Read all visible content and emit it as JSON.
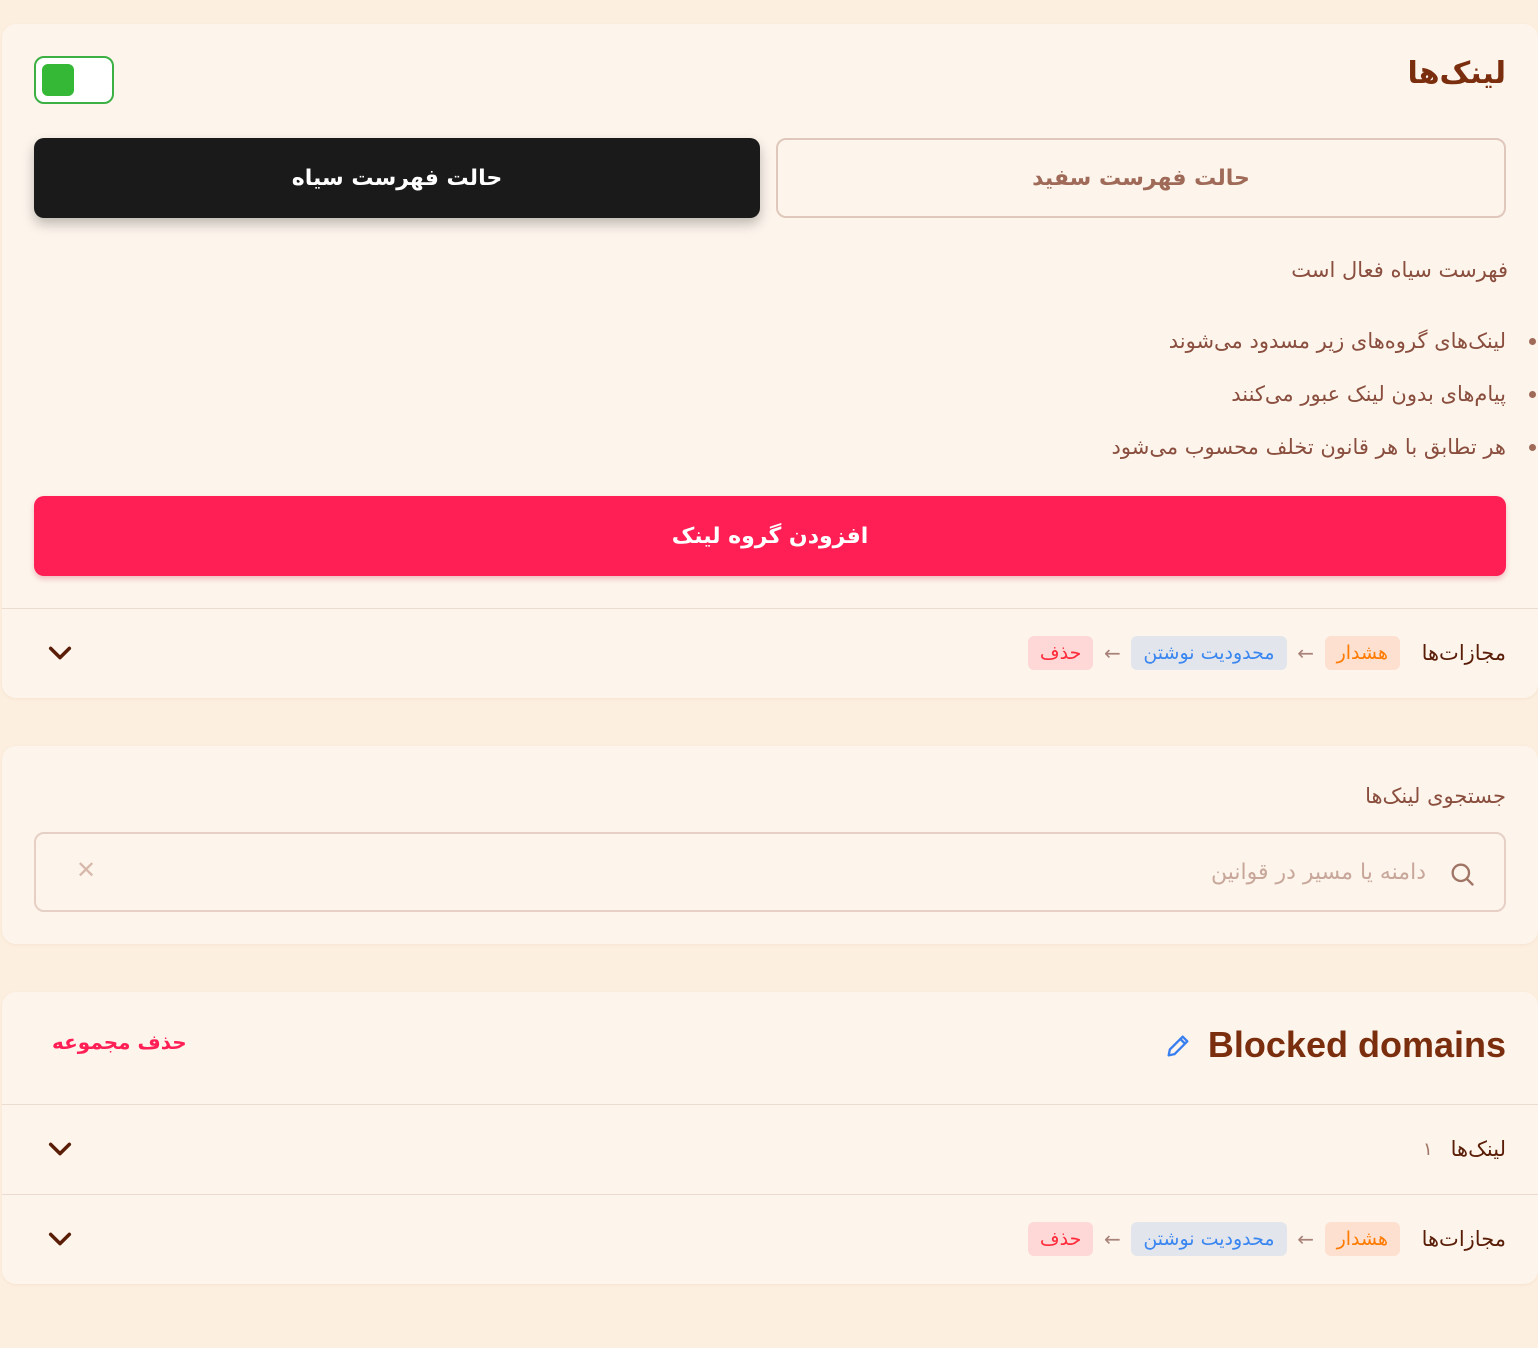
{
  "links_card": {
    "title": "لینک‌ها",
    "toggle_on": true,
    "mode_white_label": "حالت فهرست سفید",
    "mode_black_label": "حالت فهرست سیاه",
    "active_mode": "blacklist",
    "status_text": "فهرست سیاه فعال است",
    "bullets": [
      "لینک‌های گروه‌های زیر مسدود می‌شوند",
      "پیام‌های بدون لینک عبور می‌کنند",
      "هر تطابق با هر قانون تخلف محسوب می‌شود"
    ],
    "add_group_label": "افزودن گروه لینک",
    "penalties_label": "مجازات‌ها",
    "penalties": [
      "هشدار",
      "محدودیت نوشتن",
      "حذف"
    ]
  },
  "search": {
    "label": "جستجوی لینک‌ها",
    "placeholder": "دامنه یا مسیر در قوانین",
    "value": ""
  },
  "group": {
    "title": "Blocked domains",
    "delete_label": "حذف مجموعه",
    "links_label": "لینک‌ها",
    "links_count": "۱",
    "penalties_label": "مجازات‌ها",
    "penalties": [
      "هشدار",
      "محدودیت نوشتن",
      "حذف"
    ]
  },
  "colors": {
    "accent": "#ff1f55",
    "toggle_on": "#35b835",
    "warn": "#ff7a00",
    "limit": "#3a86f0",
    "delete": "#ff2a3a"
  }
}
